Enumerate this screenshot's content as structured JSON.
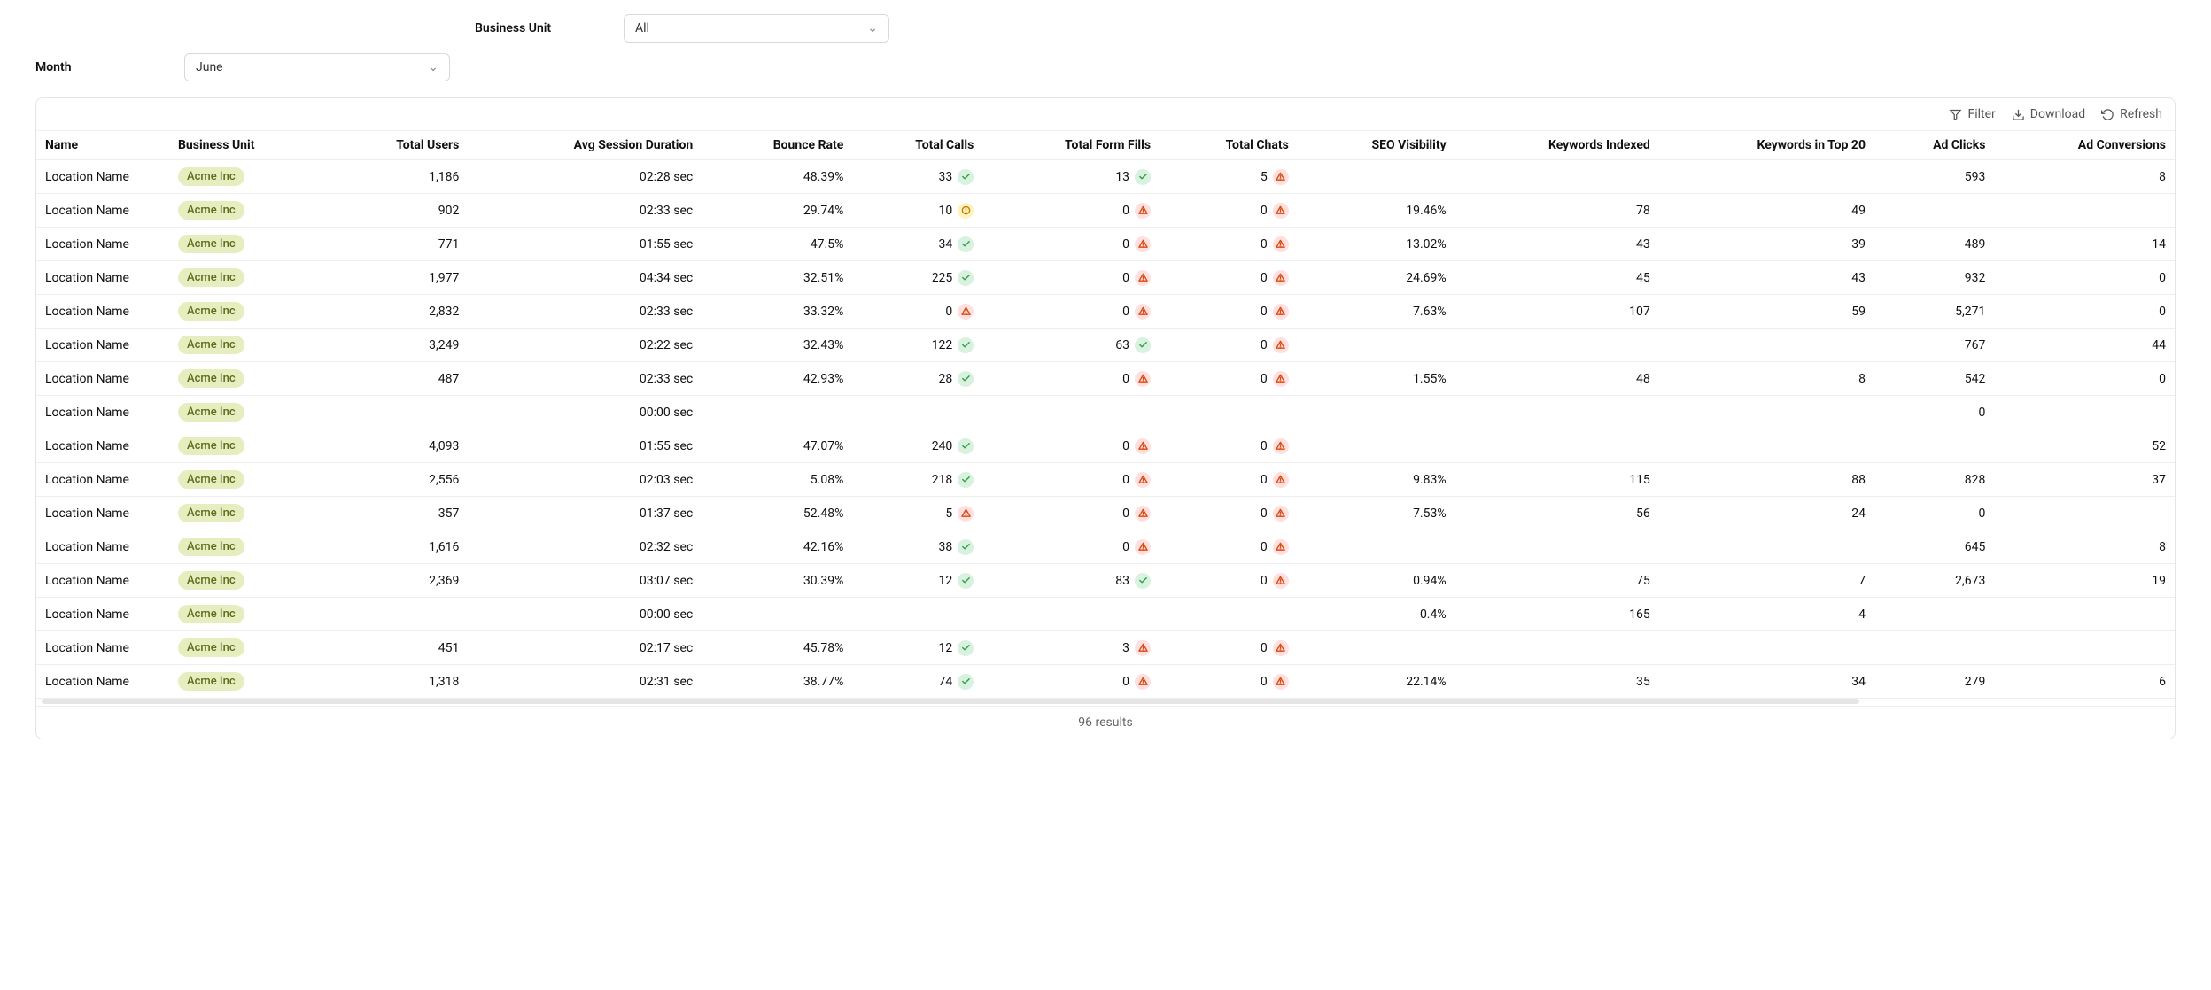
{
  "filters": {
    "business_unit_label": "Business Unit",
    "business_unit_value": "All",
    "month_label": "Month",
    "month_value": "June"
  },
  "toolbar": {
    "filter": "Filter",
    "download": "Download",
    "refresh": "Refresh"
  },
  "columns": [
    "Name",
    "Business Unit",
    "Total Users",
    "Avg Session Duration",
    "Bounce Rate",
    "Total Calls",
    "Total Form Fills",
    "Total Chats",
    "SEO Visibility",
    "Keywords Indexed",
    "Keywords in Top 20",
    "Ad Clicks",
    "Ad Conversions"
  ],
  "footer": {
    "results": "96 results"
  },
  "rows": [
    {
      "name": "Location Name",
      "bu": "Acme Inc",
      "users": "1,186",
      "dur": "02:28 sec",
      "bounce": "48.39%",
      "calls": {
        "v": "33",
        "s": "ok"
      },
      "forms": {
        "v": "13",
        "s": "ok"
      },
      "chats": {
        "v": "5",
        "s": "err"
      },
      "seo": "",
      "kidx": "",
      "ktop": "",
      "clicks": "593",
      "conv": "8"
    },
    {
      "name": "Location Name",
      "bu": "Acme Inc",
      "users": "902",
      "dur": "02:33 sec",
      "bounce": "29.74%",
      "calls": {
        "v": "10",
        "s": "warn"
      },
      "forms": {
        "v": "0",
        "s": "err"
      },
      "chats": {
        "v": "0",
        "s": "err"
      },
      "seo": "19.46%",
      "kidx": "78",
      "ktop": "49",
      "clicks": "",
      "conv": ""
    },
    {
      "name": "Location Name",
      "bu": "Acme Inc",
      "users": "771",
      "dur": "01:55 sec",
      "bounce": "47.5%",
      "calls": {
        "v": "34",
        "s": "ok"
      },
      "forms": {
        "v": "0",
        "s": "err"
      },
      "chats": {
        "v": "0",
        "s": "err"
      },
      "seo": "13.02%",
      "kidx": "43",
      "ktop": "39",
      "clicks": "489",
      "conv": "14"
    },
    {
      "name": "Location Name",
      "bu": "Acme Inc",
      "users": "1,977",
      "dur": "04:34 sec",
      "bounce": "32.51%",
      "calls": {
        "v": "225",
        "s": "ok"
      },
      "forms": {
        "v": "0",
        "s": "err"
      },
      "chats": {
        "v": "0",
        "s": "err"
      },
      "seo": "24.69%",
      "kidx": "45",
      "ktop": "43",
      "clicks": "932",
      "conv": "0"
    },
    {
      "name": "Location Name",
      "bu": "Acme Inc",
      "users": "2,832",
      "dur": "02:33 sec",
      "bounce": "33.32%",
      "calls": {
        "v": "0",
        "s": "err"
      },
      "forms": {
        "v": "0",
        "s": "err"
      },
      "chats": {
        "v": "0",
        "s": "err"
      },
      "seo": "7.63%",
      "kidx": "107",
      "ktop": "59",
      "clicks": "5,271",
      "conv": "0"
    },
    {
      "name": "Location Name",
      "bu": "Acme Inc",
      "users": "3,249",
      "dur": "02:22 sec",
      "bounce": "32.43%",
      "calls": {
        "v": "122",
        "s": "ok"
      },
      "forms": {
        "v": "63",
        "s": "ok"
      },
      "chats": {
        "v": "0",
        "s": "err"
      },
      "seo": "",
      "kidx": "",
      "ktop": "",
      "clicks": "767",
      "conv": "44"
    },
    {
      "name": "Location Name",
      "bu": "Acme Inc",
      "users": "487",
      "dur": "02:33 sec",
      "bounce": "42.93%",
      "calls": {
        "v": "28",
        "s": "ok"
      },
      "forms": {
        "v": "0",
        "s": "err"
      },
      "chats": {
        "v": "0",
        "s": "err"
      },
      "seo": "1.55%",
      "kidx": "48",
      "ktop": "8",
      "clicks": "542",
      "conv": "0"
    },
    {
      "name": "Location Name",
      "bu": "Acme Inc",
      "users": "",
      "dur": "00:00 sec",
      "bounce": "",
      "calls": null,
      "forms": null,
      "chats": null,
      "seo": "",
      "kidx": "",
      "ktop": "",
      "clicks": "0",
      "conv": ""
    },
    {
      "name": "Location Name",
      "bu": "Acme Inc",
      "users": "4,093",
      "dur": "01:55 sec",
      "bounce": "47.07%",
      "calls": {
        "v": "240",
        "s": "ok"
      },
      "forms": {
        "v": "0",
        "s": "err"
      },
      "chats": {
        "v": "0",
        "s": "err"
      },
      "seo": "",
      "kidx": "",
      "ktop": "",
      "clicks": "",
      "conv": "52"
    },
    {
      "name": "Location Name",
      "bu": "Acme Inc",
      "users": "2,556",
      "dur": "02:03 sec",
      "bounce": "5.08%",
      "calls": {
        "v": "218",
        "s": "ok"
      },
      "forms": {
        "v": "0",
        "s": "err"
      },
      "chats": {
        "v": "0",
        "s": "err"
      },
      "seo": "9.83%",
      "kidx": "115",
      "ktop": "88",
      "clicks": "828",
      "conv": "37"
    },
    {
      "name": "Location Name",
      "bu": "Acme Inc",
      "users": "357",
      "dur": "01:37 sec",
      "bounce": "52.48%",
      "calls": {
        "v": "5",
        "s": "err"
      },
      "forms": {
        "v": "0",
        "s": "err"
      },
      "chats": {
        "v": "0",
        "s": "err"
      },
      "seo": "7.53%",
      "kidx": "56",
      "ktop": "24",
      "clicks": "0",
      "conv": ""
    },
    {
      "name": "Location Name",
      "bu": "Acme Inc",
      "users": "1,616",
      "dur": "02:32 sec",
      "bounce": "42.16%",
      "calls": {
        "v": "38",
        "s": "ok"
      },
      "forms": {
        "v": "0",
        "s": "err"
      },
      "chats": {
        "v": "0",
        "s": "err"
      },
      "seo": "",
      "kidx": "",
      "ktop": "",
      "clicks": "645",
      "conv": "8"
    },
    {
      "name": "Location Name",
      "bu": "Acme Inc",
      "users": "2,369",
      "dur": "03:07 sec",
      "bounce": "30.39%",
      "calls": {
        "v": "12",
        "s": "ok"
      },
      "forms": {
        "v": "83",
        "s": "ok"
      },
      "chats": {
        "v": "0",
        "s": "err"
      },
      "seo": "0.94%",
      "kidx": "75",
      "ktop": "7",
      "clicks": "2,673",
      "conv": "19"
    },
    {
      "name": "Location Name",
      "bu": "Acme Inc",
      "users": "",
      "dur": "00:00 sec",
      "bounce": "",
      "calls": null,
      "forms": null,
      "chats": null,
      "seo": "0.4%",
      "kidx": "165",
      "ktop": "4",
      "clicks": "",
      "conv": ""
    },
    {
      "name": "Location Name",
      "bu": "Acme Inc",
      "users": "451",
      "dur": "02:17 sec",
      "bounce": "45.78%",
      "calls": {
        "v": "12",
        "s": "ok"
      },
      "forms": {
        "v": "3",
        "s": "err"
      },
      "chats": {
        "v": "0",
        "s": "err"
      },
      "seo": "",
      "kidx": "",
      "ktop": "",
      "clicks": "",
      "conv": ""
    },
    {
      "name": "Location Name",
      "bu": "Acme Inc",
      "users": "1,318",
      "dur": "02:31 sec",
      "bounce": "38.77%",
      "calls": {
        "v": "74",
        "s": "ok"
      },
      "forms": {
        "v": "0",
        "s": "err"
      },
      "chats": {
        "v": "0",
        "s": "err"
      },
      "seo": "22.14%",
      "kidx": "35",
      "ktop": "34",
      "clicks": "279",
      "conv": "6"
    }
  ]
}
